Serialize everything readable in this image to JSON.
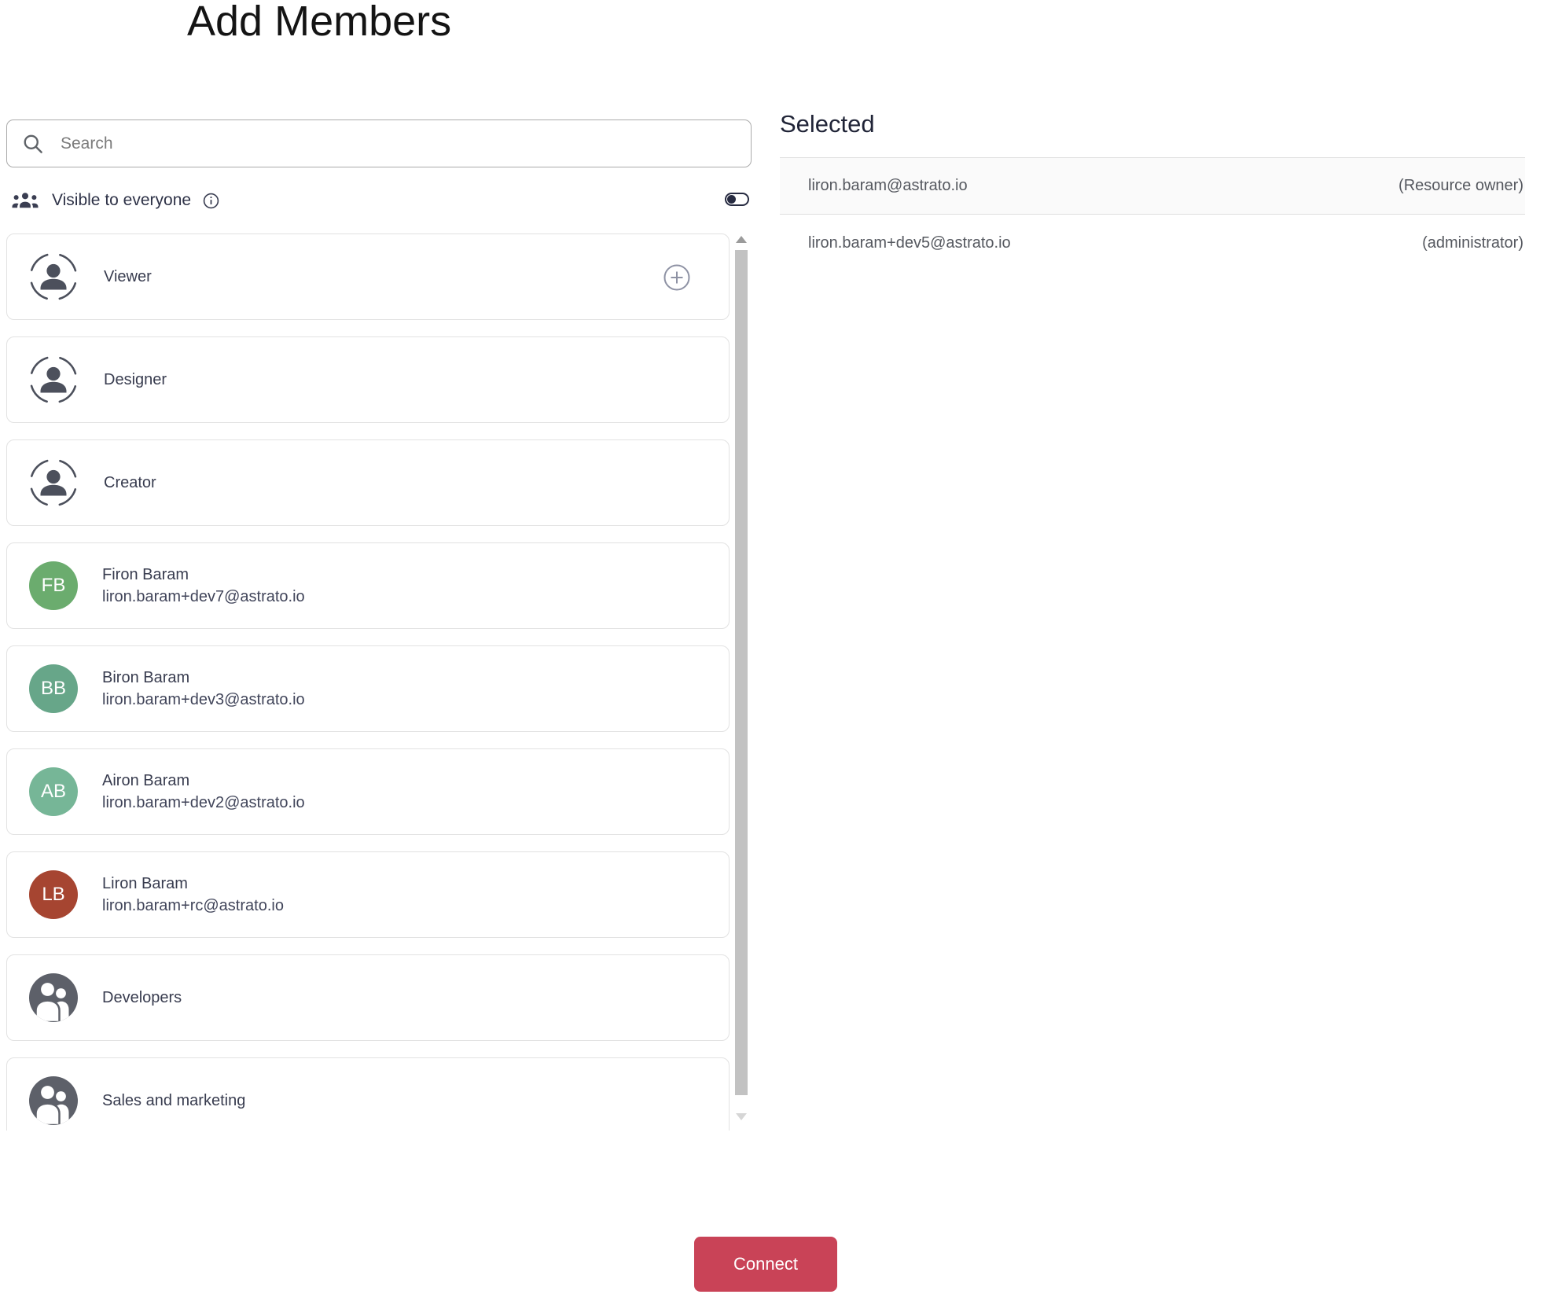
{
  "title": "Add Members",
  "search": {
    "placeholder": "Search"
  },
  "visibility": {
    "label": "Visible to everyone",
    "toggle_state": "off"
  },
  "list": [
    {
      "type": "role",
      "label": "Viewer"
    },
    {
      "type": "role",
      "label": "Designer"
    },
    {
      "type": "role",
      "label": "Creator"
    },
    {
      "type": "user",
      "name": "Firon Baram",
      "email": "liron.baram+dev7@astrato.io",
      "initials": "FB",
      "color": "#6BAC6E"
    },
    {
      "type": "user",
      "name": "Biron Baram",
      "email": "liron.baram+dev3@astrato.io",
      "initials": "BB",
      "color": "#67A689"
    },
    {
      "type": "user",
      "name": "Airon Baram",
      "email": "liron.baram+dev2@astrato.io",
      "initials": "AB",
      "color": "#76B697"
    },
    {
      "type": "user",
      "name": "Liron Baram",
      "email": "liron.baram+rc@astrato.io",
      "initials": "LB",
      "color": "#A64531"
    },
    {
      "type": "group",
      "label": "Developers"
    },
    {
      "type": "group",
      "label": "Sales and marketing"
    }
  ],
  "selected": {
    "heading": "Selected",
    "rows": [
      {
        "email": "liron.baram@astrato.io",
        "role": "(Resource owner)"
      },
      {
        "email": "liron.baram+dev5@astrato.io",
        "role": "(administrator)"
      }
    ]
  },
  "footer": {
    "connect_label": "Connect"
  },
  "colors": {
    "accent": "#C94357",
    "icon_dark": "#4C505C",
    "group_circle": "#5D6069",
    "toggle": "#272B41"
  }
}
